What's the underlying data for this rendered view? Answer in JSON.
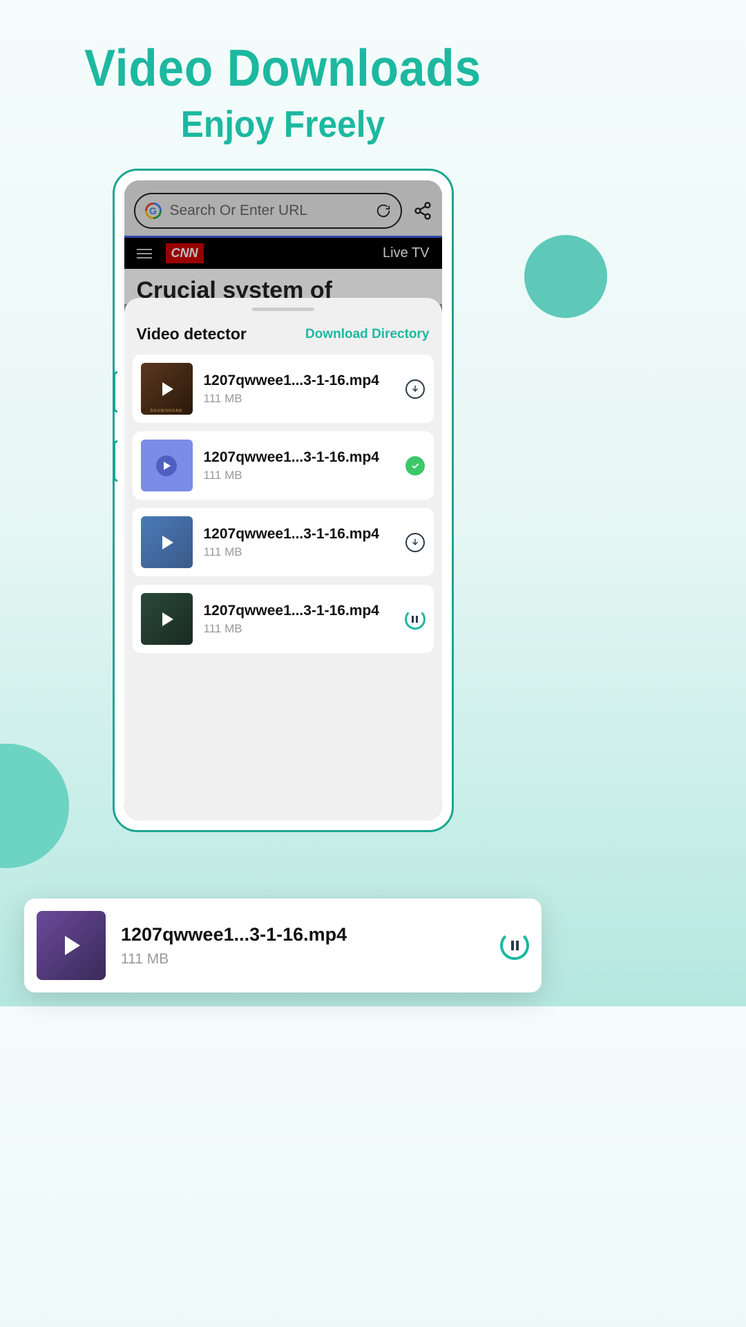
{
  "headline": {
    "main": "Video  Downloads",
    "sub": "Enjoy  Freely"
  },
  "browser": {
    "search_placeholder": "Search Or Enter URL",
    "cnn_label": "CNN",
    "live_tv": "Live TV",
    "cnn_headline": "Crucial system of"
  },
  "sheet": {
    "title": "Video detector",
    "directory_link": "Download Directory"
  },
  "videos": [
    {
      "name": "1207qwwee1...3-1-16.mp4",
      "size": "111 MB",
      "status": "download"
    },
    {
      "name": "1207qwwee1...3-1-16.mp4",
      "size": "111 MB",
      "status": "done"
    },
    {
      "name": "1207qwwee1...3-1-16.mp4",
      "size": "111 MB",
      "status": "download"
    },
    {
      "name": "1207qwwee1...3-1-16.mp4",
      "size": "111 MB",
      "status": "pause"
    }
  ],
  "floating": {
    "name": "1207qwwee1...3-1-16.mp4",
    "size": "111 MB"
  }
}
